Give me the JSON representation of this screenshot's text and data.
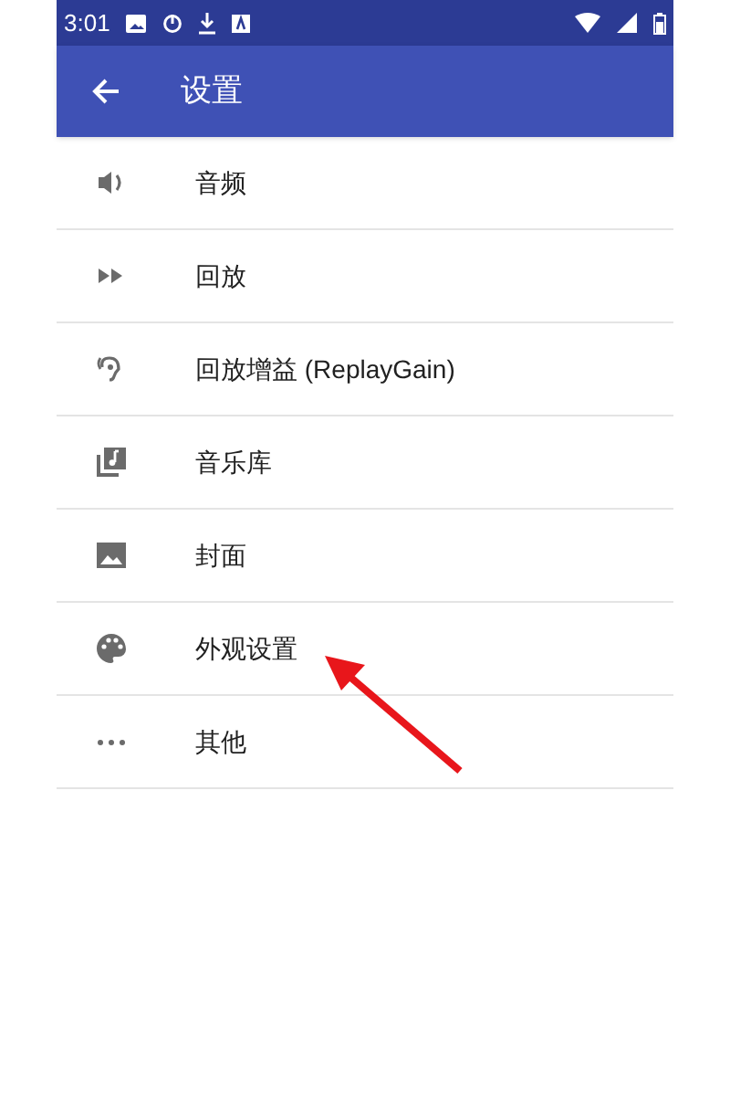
{
  "status_bar": {
    "time": "3:01"
  },
  "app_bar": {
    "title": "设置"
  },
  "items": [
    {
      "label": "音频"
    },
    {
      "label": "回放"
    },
    {
      "label": "回放增益 (ReplayGain)"
    },
    {
      "label": "音乐库"
    },
    {
      "label": "封面"
    },
    {
      "label": "外观设置"
    },
    {
      "label": "其他"
    }
  ]
}
